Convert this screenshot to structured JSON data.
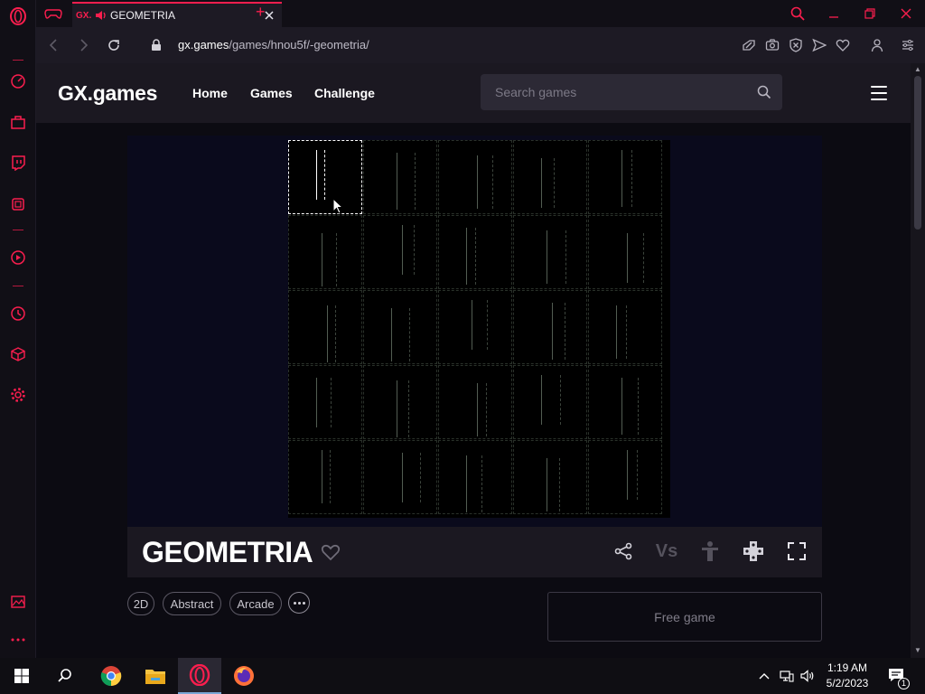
{
  "browser": {
    "tab": {
      "logo": "GX.",
      "title": "GEOMETRIA"
    },
    "address": {
      "host": "gx.games",
      "path": "/games/hnou5f/-geometria/"
    },
    "accent": "#fa1e4e"
  },
  "site": {
    "brand": "GX.games",
    "nav": [
      {
        "label": "Home"
      },
      {
        "label": "Games"
      },
      {
        "label": "Challenge"
      }
    ],
    "search": {
      "placeholder": "Search games"
    }
  },
  "game": {
    "title": "GEOMETRIA",
    "tags": [
      "2D",
      "Abstract",
      "Arcade"
    ],
    "free_label": "Free game",
    "vs_label": "Vs",
    "grid_rows": 5,
    "grid_cols": 5
  },
  "taskbar": {
    "time": "1:19 AM",
    "date": "5/2/2023",
    "notifications": "1"
  }
}
